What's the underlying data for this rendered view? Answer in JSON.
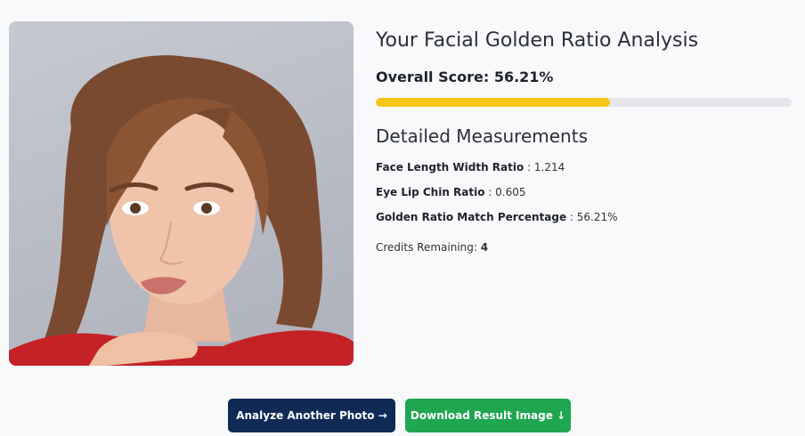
{
  "results": {
    "title": "Your Facial Golden Ratio Analysis",
    "overall_score_label": "Overall Score: 56.21%",
    "overall_score_percent": 56.21,
    "detailed_heading": "Detailed Measurements",
    "measurements": [
      {
        "label": "Face Length Width Ratio",
        "value": ": 1.214"
      },
      {
        "label": "Eye Lip Chin Ratio",
        "value": ": 0.605"
      },
      {
        "label": "Golden Ratio Match Percentage",
        "value": ": 56.21%"
      }
    ],
    "credits_label": "Credits Remaining: ",
    "credits_value": "4"
  },
  "actions": {
    "analyze_label": "Analyze Another Photo →",
    "download_label": "Download Result Image ↓"
  },
  "colors": {
    "progress_fill": "#f5c518",
    "progress_track": "#e4e6ea",
    "analyze_bg": "#0f2a55",
    "download_bg": "#1ea650"
  }
}
